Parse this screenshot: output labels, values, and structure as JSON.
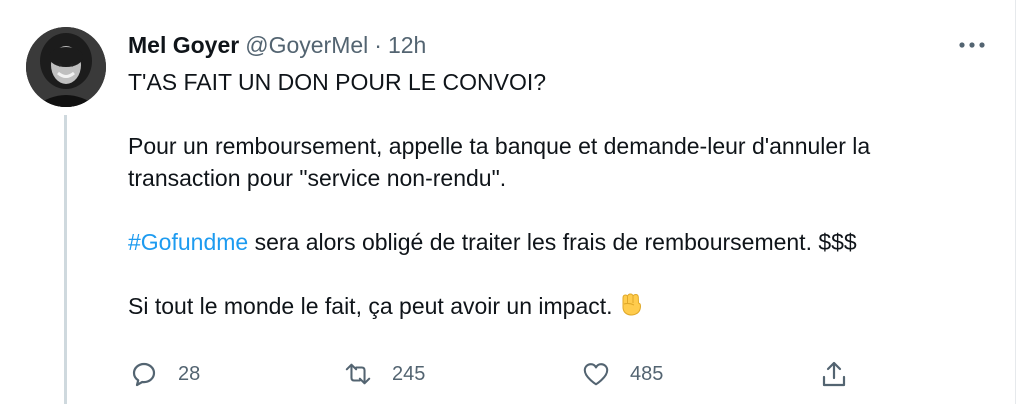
{
  "author": {
    "name": "Mel Goyer",
    "handle": "@GoyerMel",
    "separator": "·",
    "time": "12h"
  },
  "tweet": {
    "line1": "T'AS FAIT UN DON POUR LE CONVOI?",
    "para2_line1": "Pour un remboursement, appelle ta banque et demande-leur d'annuler la",
    "para2_line2": "transaction pour \"service non-rendu\".",
    "hashtag": "#Gofundme",
    "para3_rest": " sera alors obligé de traiter les frais de remboursement. $$$",
    "para4": "Si tout le monde le fait, ça peut avoir un impact."
  },
  "actions": {
    "reply_count": "28",
    "retweet_count": "245",
    "like_count": "485"
  },
  "icons": {
    "more": "more-horizontal-icon",
    "reply": "reply-icon",
    "retweet": "retweet-icon",
    "like": "heart-icon",
    "share": "share-icon",
    "emoji": "raised-fist-emoji"
  },
  "colors": {
    "text": "#0f1419",
    "secondary": "#536471",
    "link": "#1d9bf0"
  }
}
